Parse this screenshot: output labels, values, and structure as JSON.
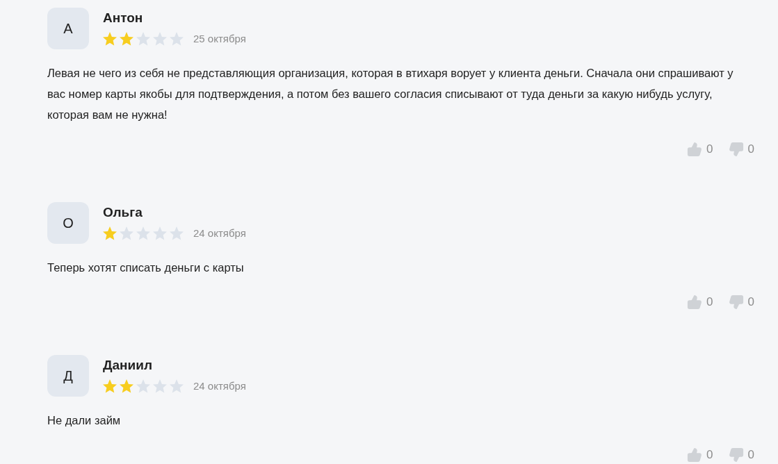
{
  "reviews": [
    {
      "avatar": "А",
      "name": "Антон",
      "stars": 2,
      "date": "25 октября",
      "text": "Левая не чего из себя не представляющия организация, которая в втихаря ворует у клиента деньги. Сначала они спрашивают у вас номер карты якобы для подтверждения, а потом без вашего согласия списывают от туда деньги за какую нибудь услугу, которая вам не нужна!",
      "likes": "0",
      "dislikes": "0"
    },
    {
      "avatar": "О",
      "name": "Ольга",
      "stars": 1,
      "date": "24 октября",
      "text": "Теперь хотят списать деньги с карты",
      "likes": "0",
      "dislikes": "0"
    },
    {
      "avatar": "Д",
      "name": "Даниил",
      "stars": 2,
      "date": "24 октября",
      "text": "Не дали займ",
      "likes": "0",
      "dislikes": "0"
    }
  ]
}
